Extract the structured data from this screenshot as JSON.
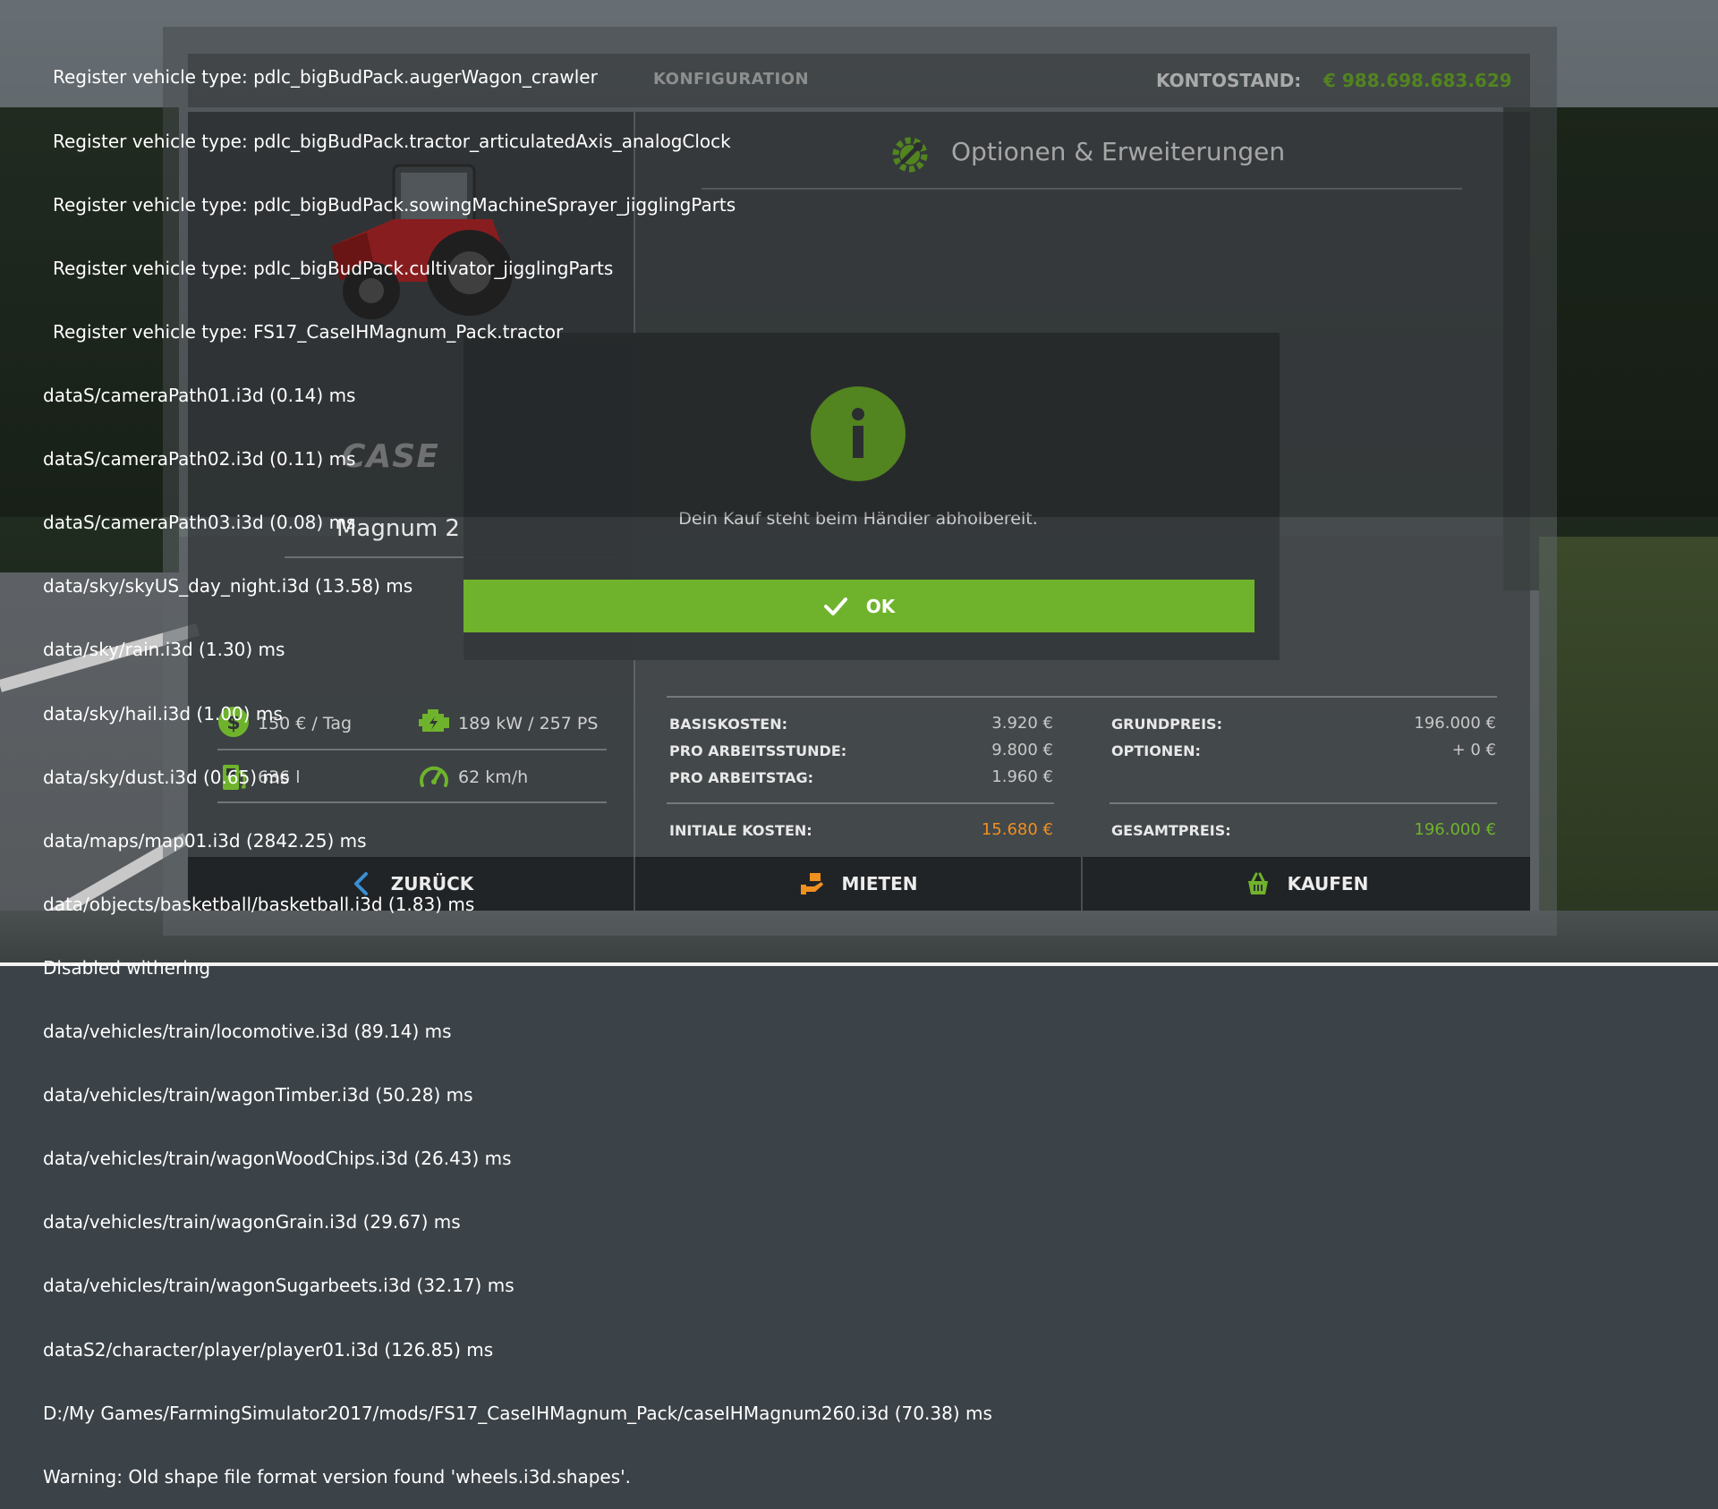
{
  "header": {
    "title": "KONFIGURATION",
    "balance_label": "KONTOSTAND:",
    "balance_value": "€ 988.698.683.629"
  },
  "options": {
    "title": "Optionen & Erweiterungen",
    "icon": "gear-wrench-icon"
  },
  "vehicle": {
    "brand": "CASE",
    "model_name": "Magnum 2"
  },
  "stats": [
    {
      "icon": "money-icon",
      "text": "150 € / Tag"
    },
    {
      "icon": "engine-icon",
      "text": "189 kW / 257 PS"
    },
    {
      "icon": "fuel-icon",
      "text": "636 l"
    },
    {
      "icon": "speedometer-icon",
      "text": "62 km/h"
    }
  ],
  "costs": {
    "base_label": "BASISKOSTEN:",
    "base_value": "3.920 €",
    "per_hour_label": "PRO ARBEITSSTUNDE:",
    "per_hour_value": "9.800 €",
    "per_day_label": "PRO ARBEITSTAG:",
    "per_day_value": "1.960 €",
    "initial_label": "INITIALE KOSTEN:",
    "initial_value": "15.680 €",
    "base_price_label": "GRUNDPREIS:",
    "base_price_value": "196.000 €",
    "options_label": "OPTIONEN:",
    "options_value": "+ 0 €",
    "total_label": "GESAMTPREIS:",
    "total_value": "196.000 €"
  },
  "buttons": {
    "back": "ZURÜCK",
    "rent": "MIETEN",
    "buy": "KAUFEN"
  },
  "modal": {
    "icon": "info-icon",
    "message": "Dein Kauf steht beim Händler abholbereit.",
    "ok_label": "OK"
  },
  "console_lines": [
    "Register vehicle type: pdlc_bigBudPack.augerWagon_crawler",
    "Register vehicle type: pdlc_bigBudPack.tractor_articulatedAxis_analogClock",
    "Register vehicle type: pdlc_bigBudPack.sowingMachineSprayer_jigglingParts",
    "Register vehicle type: pdlc_bigBudPack.cultivator_jigglingParts",
    "Register vehicle type: FS17_CaseIHMagnum_Pack.tractor",
    "dataS/cameraPath01.i3d (0.14) ms",
    "dataS/cameraPath02.i3d (0.11) ms",
    "dataS/cameraPath03.i3d (0.08) ms",
    "data/sky/skyUS_day_night.i3d (13.58) ms",
    "data/sky/rain.i3d (1.30) ms",
    "data/sky/hail.i3d (1.00) ms",
    "data/sky/dust.i3d (0.65) ms",
    "data/maps/map01.i3d (2842.25) ms",
    "data/objects/basketball/basketball.i3d (1.83) ms",
    "Disabled withering",
    "data/vehicles/train/locomotive.i3d (89.14) ms",
    "data/vehicles/train/wagonTimber.i3d (50.28) ms",
    "data/vehicles/train/wagonWoodChips.i3d (26.43) ms",
    "data/vehicles/train/wagonGrain.i3d (29.67) ms",
    "data/vehicles/train/wagonSugarbeets.i3d (32.17) ms",
    "dataS2/character/player/player01.i3d (126.85) ms",
    "D:/My Games/FarmingSimulator2017/mods/FS17_CaseIHMagnum_Pack/caseIHMagnum260.i3d (70.38) ms",
    "Warning: Old shape file format version found 'wheels.i3d.shapes'."
  ],
  "colors": {
    "accent_green": "#6fb32c",
    "accent_orange": "#f0901e",
    "back_arrow_blue": "#3a8fd6"
  }
}
